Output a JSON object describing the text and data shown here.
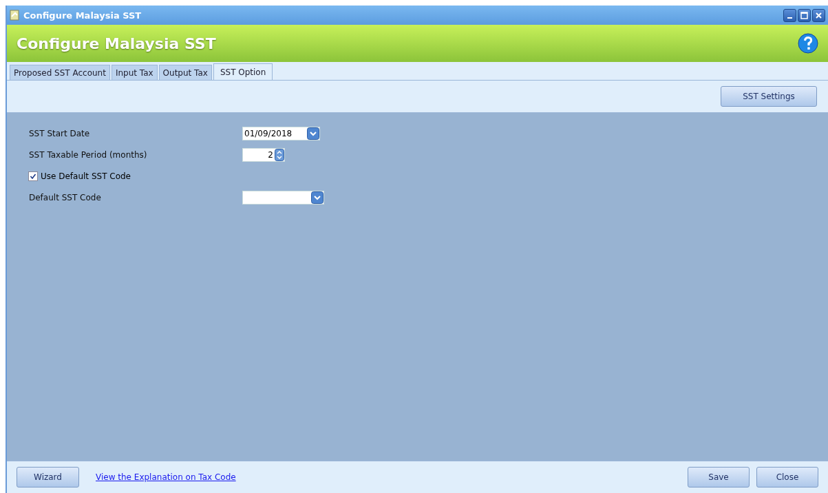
{
  "window": {
    "title": "Configure Malaysia SST"
  },
  "header": {
    "title": "Configure Malaysia SST"
  },
  "tabs": [
    {
      "label": "Proposed SST Account",
      "selected": false
    },
    {
      "label": "Input Tax",
      "selected": false
    },
    {
      "label": "Output Tax",
      "selected": false
    },
    {
      "label": "SST Option",
      "selected": true
    }
  ],
  "toolbar": {
    "buttons": [
      "SST Settings"
    ]
  },
  "form": [
    {
      "kind": "date",
      "label": "SST Start Date",
      "value": "01/09/2018"
    },
    {
      "kind": "spin",
      "label": "SST Taxable Period (months)",
      "value": "2"
    },
    {
      "kind": "checkbox",
      "label": "Use Default SST Code",
      "checked": true
    },
    {
      "kind": "combo",
      "label": "Default SST Code"
    }
  ],
  "footer": {
    "wizard": "Wizard",
    "link": "View the Explanation on Tax Code",
    "buttons": [
      "Save",
      "Close"
    ]
  }
}
